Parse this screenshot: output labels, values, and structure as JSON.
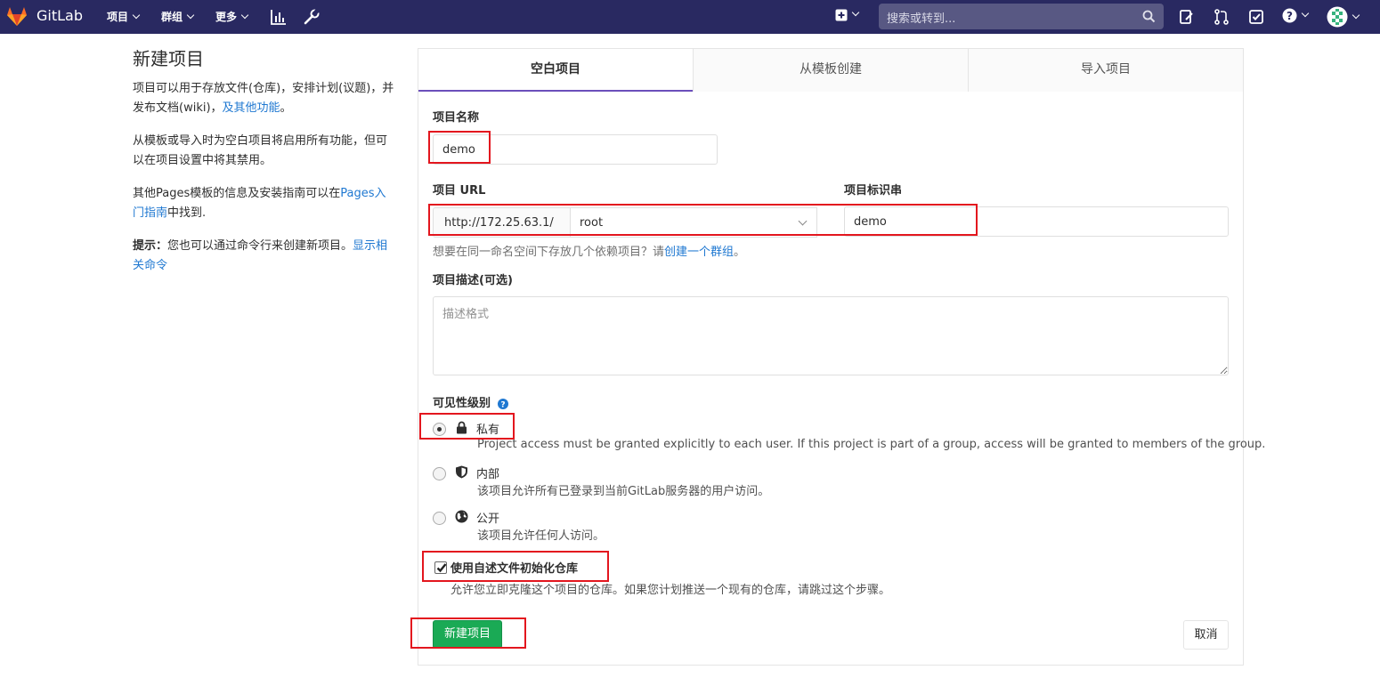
{
  "navbar": {
    "brand": "GitLab",
    "menu": [
      {
        "label": "项目"
      },
      {
        "label": "群组"
      },
      {
        "label": "更多"
      }
    ],
    "search_placeholder": "搜索或转到..."
  },
  "sidebar": {
    "title": "新建项目",
    "p1_text": "项目可以用于存放文件(仓库)，安排计划(议题)，并发布文档(wiki)，",
    "p1_link": "及其他功能",
    "p1_end": "。",
    "p2": "从模板或导入时为空白项目将启用所有功能，但可以在项目设置中将其禁用。",
    "p3_text": "其他Pages模板的信息及安装指南可以在",
    "p3_link": "Pages入门指南",
    "p3_end": "中找到.",
    "tip_label": "提示：",
    "tip_text": "您也可以通过命令行来创建新项目。",
    "tip_link": "显示相关命令"
  },
  "tabs": [
    {
      "label": "空白项目",
      "active": true
    },
    {
      "label": "从模板创建",
      "active": false
    },
    {
      "label": "导入项目",
      "active": false
    }
  ],
  "form": {
    "name_label": "项目名称",
    "name_value": "demo",
    "url_label": "项目 URL",
    "url_prefix": "http://172.25.63.1/",
    "namespace": "root",
    "slug_label": "项目标识串",
    "slug_value": "demo",
    "group_help_text": "想要在同一命名空间下存放几个依赖项目？请",
    "group_help_link": "创建一个群组",
    "group_help_end": "。",
    "desc_label": "项目描述(可选)",
    "desc_placeholder": "描述格式",
    "visibility_label": "可见性级别",
    "visibility": [
      {
        "title": "私有",
        "desc": "Project access must be granted explicitly to each user. If this project is part of a group, access will be granted to members of the group.",
        "checked": true,
        "icon": "lock-icon"
      },
      {
        "title": "内部",
        "desc": "该项目允许所有已登录到当前GitLab服务器的用户访问。",
        "checked": false,
        "icon": "shield-icon"
      },
      {
        "title": "公开",
        "desc": "该项目允许任何人访问。",
        "checked": false,
        "icon": "globe-icon"
      }
    ],
    "readme_label": "使用自述文件初始化仓库",
    "readme_checked": true,
    "readme_desc": "允许您立即克隆这个项目的仓库。如果您计划推送一个现有的仓库，请跳过这个步骤。",
    "create_button": "新建项目",
    "cancel_button": "取消"
  },
  "colors": {
    "navbar_bg": "#292961",
    "primary_button": "#1aaa55",
    "link": "#1f78d1",
    "tab_active_border": "#6b4fbb",
    "annotation_box": "#e3161e"
  }
}
